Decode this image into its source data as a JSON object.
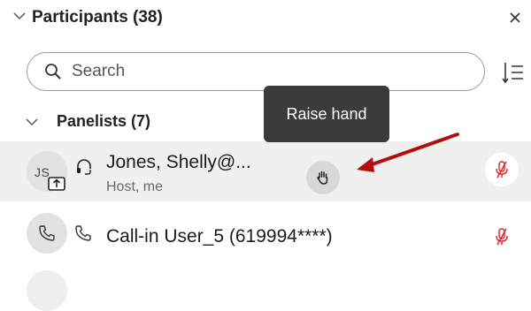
{
  "header": {
    "title": "Participants (38)",
    "icons": {
      "collapse": "chevron-down-icon",
      "close": "close-icon"
    }
  },
  "search": {
    "placeholder": "Search",
    "icons": {
      "search": "search-icon",
      "sort": "sort-list-icon"
    }
  },
  "section": {
    "title": "Panelists (7)",
    "icon": "chevron-down-icon"
  },
  "tooltip": {
    "text": "Raise hand"
  },
  "participants": [
    {
      "avatar_initials": "JS",
      "name": "Jones, Shelly@...",
      "role": "Host, me",
      "icons": [
        "share-screen-icon",
        "headset-icon",
        "raise-hand-icon",
        "microphone-muted-icon"
      ],
      "highlighted": true
    },
    {
      "name": "Call-in User_5 (619994****)",
      "icons": [
        "phone-icon",
        "phone-icon",
        "microphone-muted-icon"
      ]
    }
  ],
  "colors": {
    "mute_red": "#d92d2d",
    "arrow_red": "#b30f0f",
    "tooltip_bg": "#3b3b3b",
    "row_highlight": "#f0f0f0"
  }
}
